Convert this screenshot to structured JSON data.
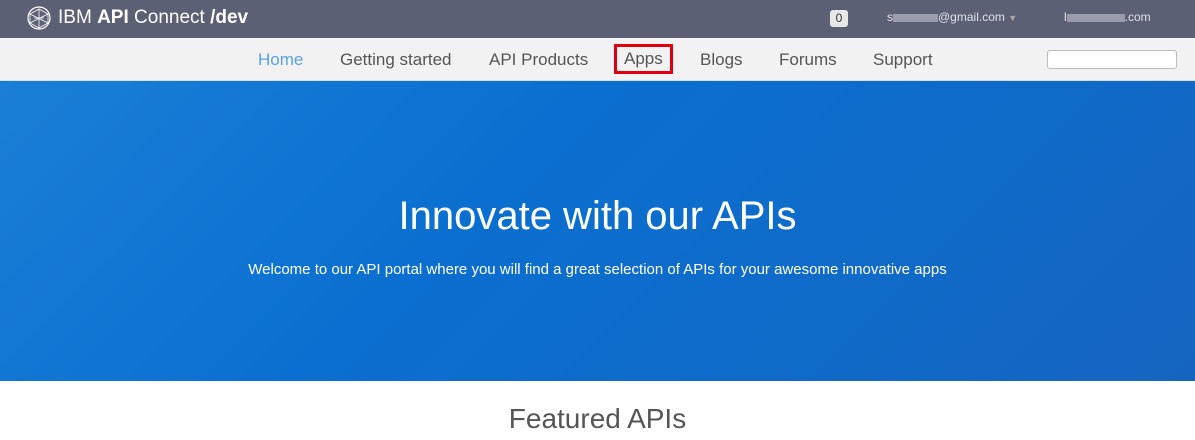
{
  "header": {
    "brand_prefix": "IBM",
    "brand_bold": "API",
    "brand_mid": " Connect",
    "brand_suffix": "/dev",
    "notification_count": "0",
    "user_email_start": "s",
    "user_email_end": "@gmail.com",
    "org_start": "l",
    "org_end": ".com"
  },
  "nav": {
    "items": [
      {
        "label": "Home"
      },
      {
        "label": "Getting started"
      },
      {
        "label": "API Products"
      },
      {
        "label": "Apps"
      },
      {
        "label": "Blogs"
      },
      {
        "label": "Forums"
      },
      {
        "label": "Support"
      }
    ],
    "search_value": ""
  },
  "hero": {
    "title": "Innovate with our APIs",
    "subtitle": "Welcome to our API portal where you will find a great selection of APIs for your awesome innovative apps"
  },
  "featured": {
    "heading": "Featured APIs"
  },
  "colors": {
    "accent": "#5aa0e8",
    "highlight": "#e00010",
    "topbar": "#5c6074"
  }
}
